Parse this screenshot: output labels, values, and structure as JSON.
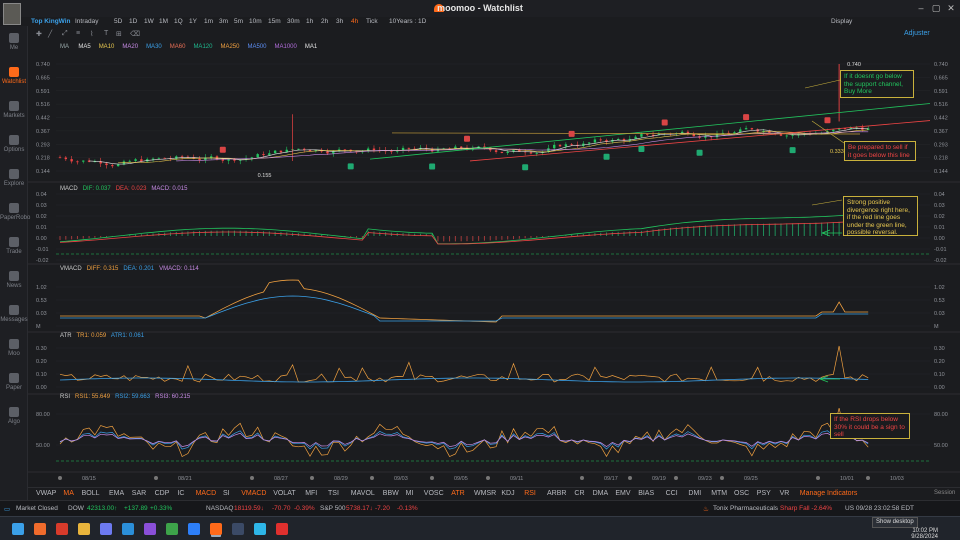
{
  "app": {
    "name": "moomoo",
    "title": "moomoo - Watchlist",
    "symbol_name": "Top KingWin"
  },
  "periods": [
    "Intraday",
    "5D",
    "1D",
    "1W",
    "1M",
    "1Q",
    "1Y",
    "1m",
    "3m",
    "5m",
    "10m",
    "15m",
    "30m",
    "1h",
    "2h",
    "3h",
    "4h",
    "Tick",
    "10Years : 1D"
  ],
  "active_period": "4h",
  "display_label": "Display",
  "adjustment_label": "Adjuster",
  "nav": [
    {
      "label": "Me"
    },
    {
      "label": "Watchlist"
    },
    {
      "label": "Markets"
    },
    {
      "label": "Options"
    },
    {
      "label": "Explore"
    },
    {
      "label": "PaperRobo"
    },
    {
      "label": "Trade"
    },
    {
      "label": "News"
    },
    {
      "label": "Messages"
    },
    {
      "label": "Moo"
    },
    {
      "label": "Paper"
    },
    {
      "label": "Algo"
    }
  ],
  "active_nav": "Watchlist",
  "colors": {
    "accent": "#ff6a1a",
    "up": "#22c55e",
    "down": "#ef4444",
    "bg": "#1b1c1f"
  },
  "price_panel": {
    "title": "MA",
    "ma_labels": [
      {
        "t": "MA5",
        "c": "#e4e4e4"
      },
      {
        "t": "MA10",
        "c": "#e8c850"
      },
      {
        "t": "MA20",
        "c": "#c88be6"
      },
      {
        "t": "MA30",
        "c": "#3ba0e8"
      },
      {
        "t": "MA60",
        "c": "#e86f56"
      },
      {
        "t": "MA120",
        "c": "#1fb88e"
      },
      {
        "t": "MA250",
        "c": "#f0a040"
      },
      {
        "t": "MA500",
        "c": "#5b8cf0"
      },
      {
        "t": "MA1000",
        "c": "#b06cd9"
      },
      {
        "t": "MA1",
        "c": "#e4e4e4"
      }
    ],
    "y_ticks": [
      "0.740",
      "0.665",
      "0.591",
      "0.516",
      "0.442",
      "0.367",
      "0.293",
      "0.218",
      "0.144"
    ],
    "high_label": "0.740",
    "low_label": "0.155",
    "level_label": "0.333",
    "annotation_green": "If it doesnt go below the support channel, Buy More",
    "annotation_red": "Be prepared to sell if it goes below this line"
  },
  "macd_panel": {
    "name": "MACD",
    "dif": "DIF: 0.037",
    "dea": "DEA: 0.023",
    "macd": "MACD: 0.015",
    "y_ticks": [
      "0.04",
      "0.03",
      "0.02",
      "0.01",
      "0.00",
      "-0.01",
      "-0.02"
    ],
    "annotation": "Strong positive divergence right here, if the red line goes under the green line, possible reversal."
  },
  "vmacd_panel": {
    "name": "VMACD",
    "diff": "DIFF: 0.315",
    "dea": "DEA: 0.201",
    "vmacd": "VMACD: 0.114",
    "y_ticks": [
      "1.02",
      "0.53",
      "0.03",
      "M"
    ]
  },
  "atr_panel": {
    "name": "ATR",
    "tr": "TR1: 0.059",
    "atr": "ATR1: 0.061",
    "y_ticks": [
      "0.30",
      "0.20",
      "0.10",
      "0.00"
    ]
  },
  "rsi_panel": {
    "name": "RSI",
    "rsi1": "RSI1: 55.649",
    "rsi2": "RSI2: 59.663",
    "rsi3": "RSI3: 60.215",
    "y_ticks": [
      "80.00",
      "50.00"
    ],
    "annotation": "If the RSI drops below 30% it could be a sign to sell"
  },
  "x_dates": [
    "08/15",
    "08/21",
    "08/27",
    "08/29",
    "09/03",
    "09/05",
    "09/11",
    "09/17",
    "09/19",
    "09/23",
    "09/25",
    "10/01",
    "10/03"
  ],
  "indicators": [
    "VWAP",
    "MA",
    "BOLL",
    "EMA",
    "SAR",
    "CDP",
    "IC",
    "MACD",
    "SI",
    "VMACD",
    "VOLAT",
    "MFI",
    "TSI",
    "MAVOL",
    "BBW",
    "MI",
    "VOSC",
    "ATR",
    "WMSR",
    "KDJ",
    "RSI",
    "ARBR",
    "CR",
    "DMA",
    "EMV",
    "BIAS",
    "CCI",
    "DMI",
    "MTM",
    "OSC",
    "PSY",
    "VR"
  ],
  "active_indicators": [
    "MA",
    "MACD",
    "VMACD",
    "ATR",
    "RSI"
  ],
  "manage_indicators": "Manage Indicators",
  "session_label": "Session",
  "status": {
    "market": "Market Closed",
    "dow": "DOW",
    "dow_val": "42313.00↑",
    "dow_chg": "+137.89",
    "dow_pct": "+0.33%",
    "nasdaq": "NASDAQ",
    "nasdaq_val": "18119.59↓",
    "nasdaq_chg": "-70.70",
    "nasdaq_pct": "-0.39%",
    "sp": "S&P 500",
    "sp_val": "5738.17↓",
    "sp_chg": "-7.20",
    "sp_pct": "-0.13%",
    "news_ticker": "Tonix Pharmaceuticals",
    "news_event": "Sharp Fall -2.64%",
    "clock": "US 09/28 23:02:58 EDT"
  },
  "taskbar": {
    "time": "10:02 PM",
    "date": "9/28/2024",
    "tooltip": "Show desktop"
  }
}
